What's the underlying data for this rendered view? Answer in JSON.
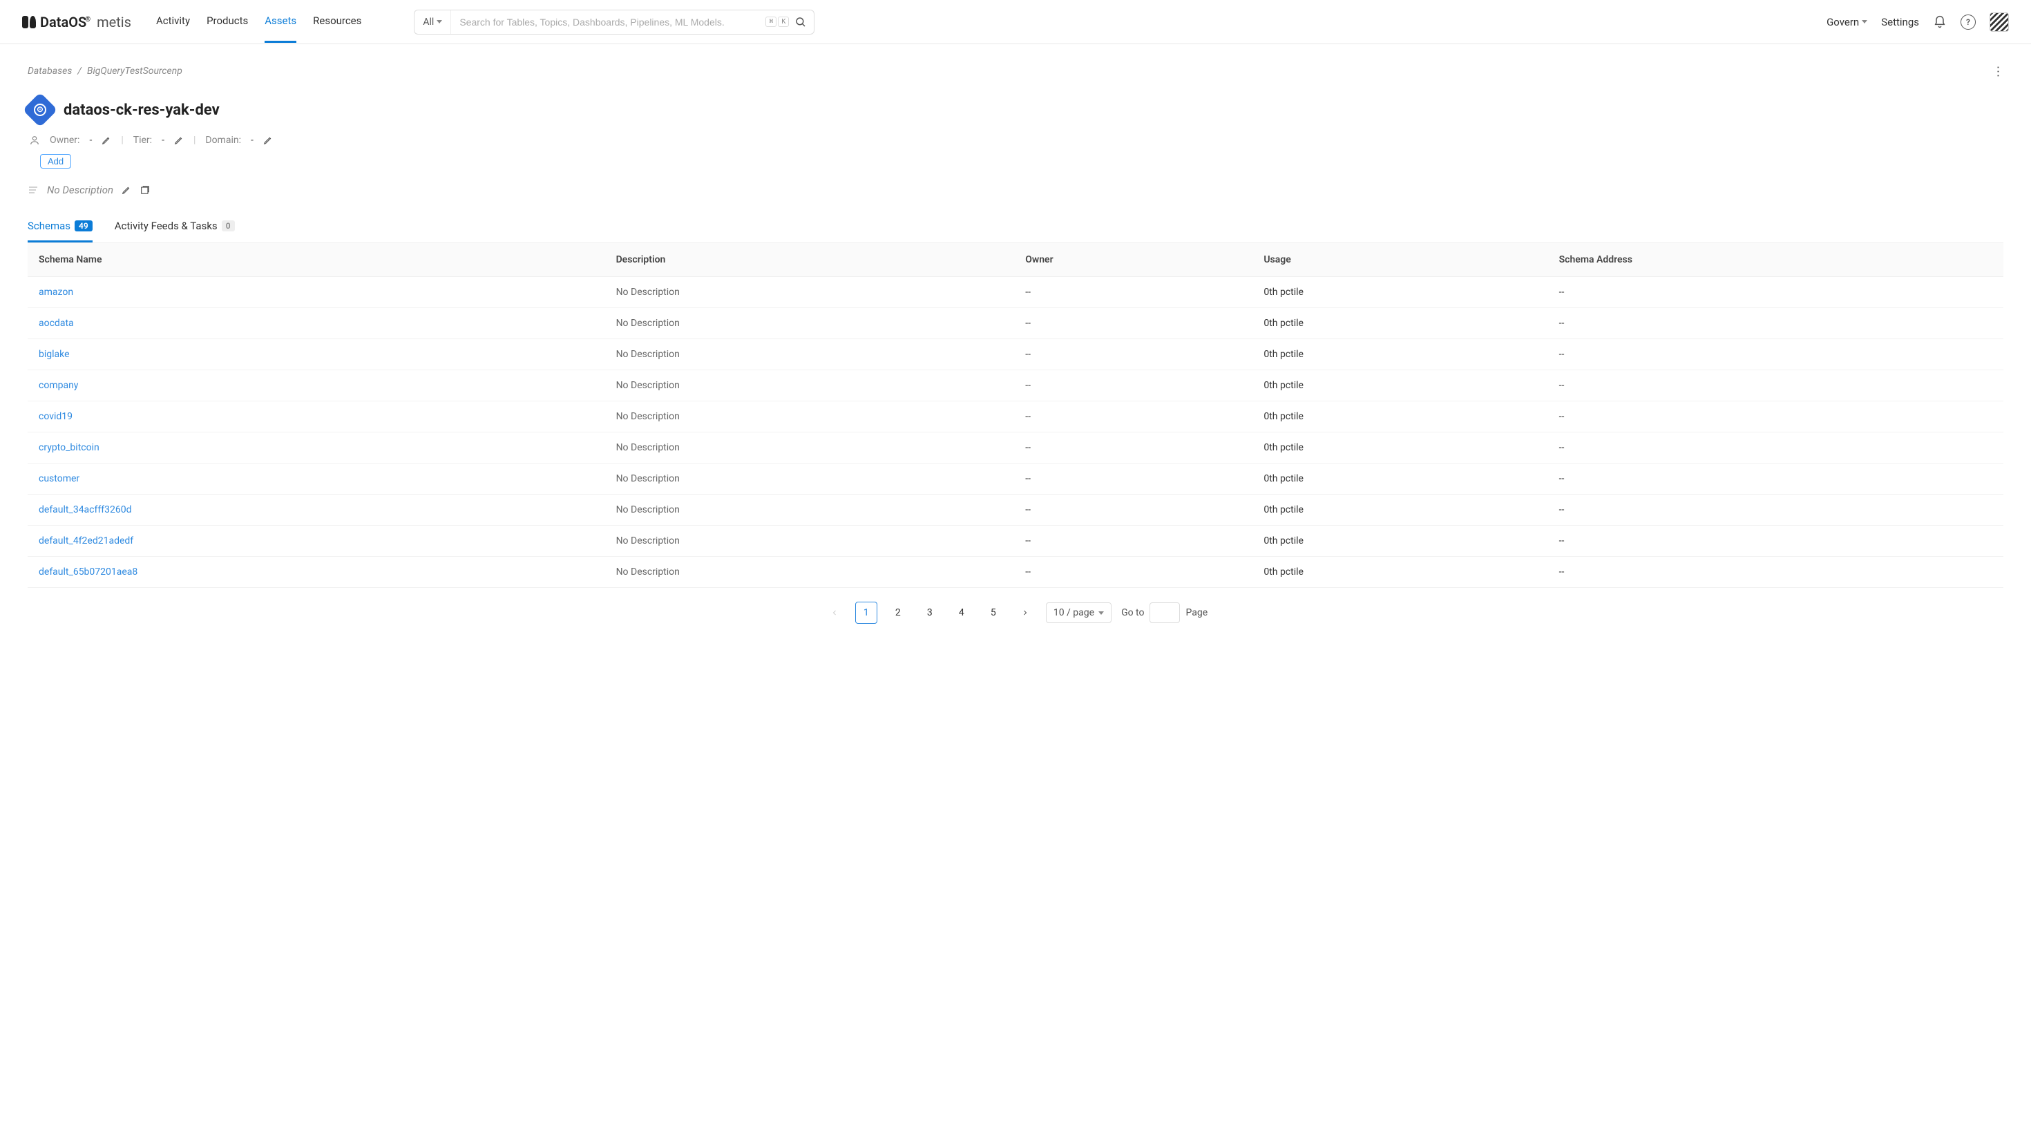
{
  "brand": {
    "name": "DataOS",
    "reg": "®",
    "sub": "metis"
  },
  "nav": {
    "activity": "Activity",
    "products": "Products",
    "assets": "Assets",
    "resources": "Resources"
  },
  "search": {
    "scope": "All",
    "placeholder": "Search for Tables, Topics, Dashboards, Pipelines, ML Models.",
    "kbd1": "⌘",
    "kbd2": "K"
  },
  "header": {
    "govern": "Govern",
    "settings": "Settings"
  },
  "breadcrumb": {
    "root": "Databases",
    "sep": "/",
    "current": "BigQueryTestSourcenp"
  },
  "page": {
    "title": "dataos-ck-res-yak-dev"
  },
  "meta": {
    "owner_label": "Owner:",
    "owner_value": "-",
    "tier_label": "Tier:",
    "tier_value": "-",
    "domain_label": "Domain:",
    "domain_value": "-"
  },
  "add_tag": "Add",
  "description": {
    "placeholder": "No Description"
  },
  "tabs": {
    "schemas_label": "Schemas",
    "schemas_count": "49",
    "activity_label": "Activity Feeds & Tasks",
    "activity_count": "0"
  },
  "table": {
    "columns": {
      "name": "Schema Name",
      "description": "Description",
      "owner": "Owner",
      "usage": "Usage",
      "address": "Schema Address"
    },
    "rows": [
      {
        "name": "amazon",
        "description": "No Description",
        "owner": "--",
        "usage": "0th pctile",
        "address": "--"
      },
      {
        "name": "aocdata",
        "description": "No Description",
        "owner": "--",
        "usage": "0th pctile",
        "address": "--"
      },
      {
        "name": "biglake",
        "description": "No Description",
        "owner": "--",
        "usage": "0th pctile",
        "address": "--"
      },
      {
        "name": "company",
        "description": "No Description",
        "owner": "--",
        "usage": "0th pctile",
        "address": "--"
      },
      {
        "name": "covid19",
        "description": "No Description",
        "owner": "--",
        "usage": "0th pctile",
        "address": "--"
      },
      {
        "name": "crypto_bitcoin",
        "description": "No Description",
        "owner": "--",
        "usage": "0th pctile",
        "address": "--"
      },
      {
        "name": "customer",
        "description": "No Description",
        "owner": "--",
        "usage": "0th pctile",
        "address": "--"
      },
      {
        "name": "default_34acfff3260d",
        "description": "No Description",
        "owner": "--",
        "usage": "0th pctile",
        "address": "--"
      },
      {
        "name": "default_4f2ed21adedf",
        "description": "No Description",
        "owner": "--",
        "usage": "0th pctile",
        "address": "--"
      },
      {
        "name": "default_65b07201aea8",
        "description": "No Description",
        "owner": "--",
        "usage": "0th pctile",
        "address": "--"
      }
    ]
  },
  "pagination": {
    "pages": [
      "1",
      "2",
      "3",
      "4",
      "5"
    ],
    "current": "1",
    "page_size_label": "10 / page",
    "goto_label": "Go to",
    "page_suffix": "Page"
  }
}
